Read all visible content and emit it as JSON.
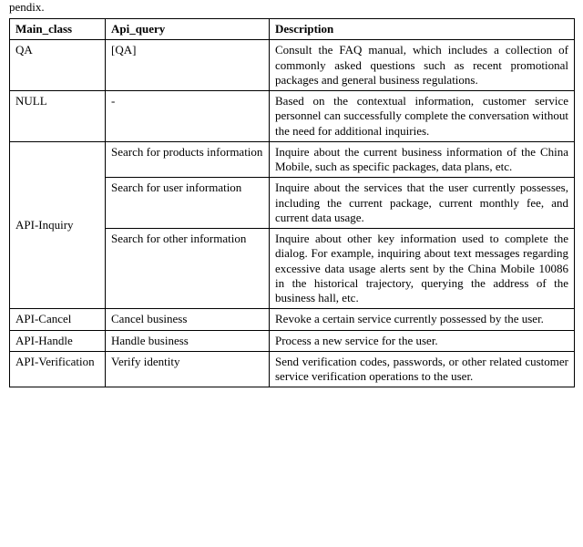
{
  "pretext": "pendix.",
  "headers": {
    "main_class": "Main_class",
    "api_query": "Api_query",
    "description": "Description"
  },
  "rows": {
    "qa": {
      "main_class": "QA",
      "api_query": "[QA]",
      "description": "Consult the FAQ manual, which includes a collection of commonly asked questions such as recent promotional packages and general business regulations."
    },
    "null": {
      "main_class": "NULL",
      "api_query": "-",
      "description": "Based on the contextual information, customer service personnel can successfully complete the conversation without the need for additional inquiries."
    },
    "api_inquiry": {
      "main_class": "API-Inquiry",
      "sub": [
        {
          "api_query": "Search for products information",
          "description": "Inquire about the current business information of the China Mobile, such as specific packages, data plans, etc."
        },
        {
          "api_query": "Search for user information",
          "description": "Inquire about the services that the user currently possesses, including the current package, current monthly fee, and current data usage."
        },
        {
          "api_query": "Search for other information",
          "description": "Inquire about other key information used to complete the dialog. For example, inquiring about text messages regarding excessive data usage alerts sent by the China Mobile 10086 in the historical trajectory, querying the address of the business hall, etc."
        }
      ]
    },
    "api_cancel": {
      "main_class": "API-Cancel",
      "api_query": "Cancel business",
      "description": "Revoke a certain service currently possessed by the user."
    },
    "api_handle": {
      "main_class": "API-Handle",
      "api_query": "Handle business",
      "description": "Process a new service for the user."
    },
    "api_verification": {
      "main_class": "API-Verification",
      "api_query": "Verify identity",
      "description": "Send verification codes, passwords, or other related customer service verification operations to the user."
    }
  },
  "chart_data": {
    "type": "table",
    "columns": [
      "Main_class",
      "Api_query",
      "Description"
    ],
    "rows": [
      [
        "QA",
        "[QA]",
        "Consult the FAQ manual, which includes a collection of commonly asked questions such as recent promotional packages and general business regulations."
      ],
      [
        "NULL",
        "-",
        "Based on the contextual information, customer service personnel can successfully complete the conversation without the need for additional inquiries."
      ],
      [
        "API-Inquiry",
        "Search for products information",
        "Inquire about the current business information of the China Mobile, such as specific packages, data plans, etc."
      ],
      [
        "API-Inquiry",
        "Search for user information",
        "Inquire about the services that the user currently possesses, including the current package, current monthly fee, and current data usage."
      ],
      [
        "API-Inquiry",
        "Search for other information",
        "Inquire about other key information used to complete the dialog. For example, inquiring about text messages regarding excessive data usage alerts sent by the China Mobile 10086 in the historical trajectory, querying the address of the business hall, etc."
      ],
      [
        "API-Cancel",
        "Cancel business",
        "Revoke a certain service currently possessed by the user."
      ],
      [
        "API-Handle",
        "Handle business",
        "Process a new service for the user."
      ],
      [
        "API-Verification",
        "Verify identity",
        "Send verification codes, passwords, or other related customer service verification operations to the user."
      ]
    ]
  }
}
